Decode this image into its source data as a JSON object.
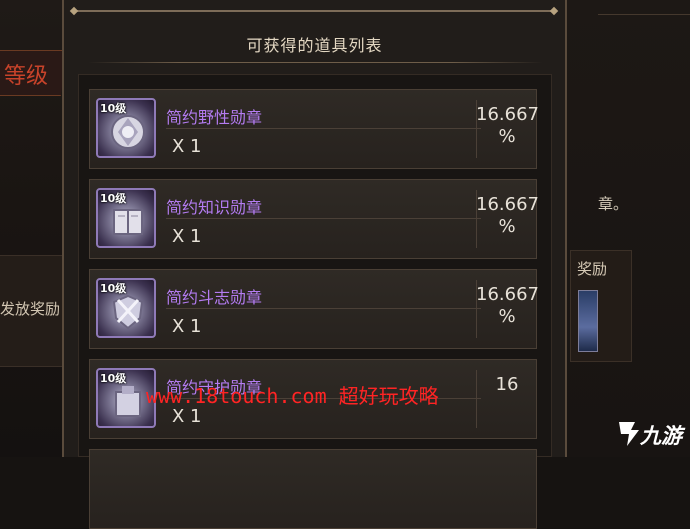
{
  "background": {
    "left_level_label": "等级",
    "left_reward_label": "发放奖励",
    "right_chapter_text": "章。",
    "right_reward_label": "奖励"
  },
  "panel": {
    "title": "可获得的道具列表"
  },
  "items": [
    {
      "level": "10级",
      "name": "简约野性勋章",
      "qty": "X 1",
      "prob_value": "16.667",
      "prob_unit": "%",
      "icon": "wild-medal-icon"
    },
    {
      "level": "10级",
      "name": "简约知识勋章",
      "qty": "X 1",
      "prob_value": "16.667",
      "prob_unit": "%",
      "icon": "knowledge-medal-icon"
    },
    {
      "level": "10级",
      "name": "简约斗志勋章",
      "qty": "X 1",
      "prob_value": "16.667",
      "prob_unit": "%",
      "icon": "fighting-spirit-medal-icon"
    },
    {
      "level": "10级",
      "name": "简约守护勋章",
      "qty": "X 1",
      "prob_value": "16",
      "prob_unit": "",
      "icon": "guardian-medal-icon"
    }
  ],
  "watermark": "www.18touch.com 超好玩攻略",
  "logo": {
    "text": "九游",
    "icon": "ninegame-logo-icon"
  },
  "colors": {
    "item_name": "#b47cf2",
    "watermark": "#ff2424",
    "level_text": "#c8432a"
  }
}
